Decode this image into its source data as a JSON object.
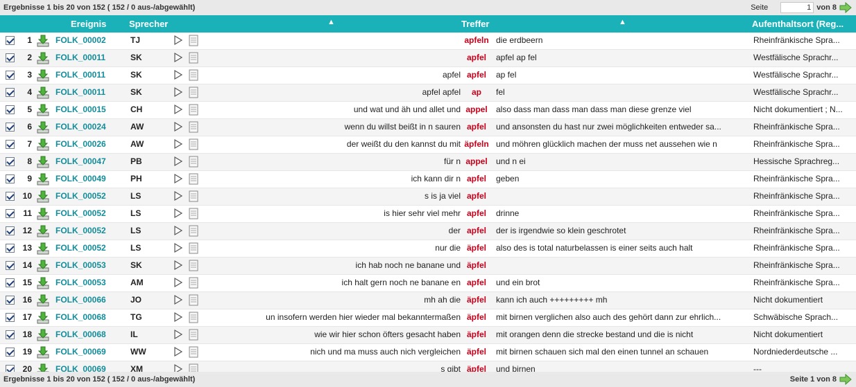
{
  "summary": "Ergebnisse 1 bis 20 von 152 ( 152 / 0 aus-/abgewählt)",
  "pager_top": {
    "label": "Seite",
    "value": "1",
    "suffix": "von 8"
  },
  "pager_bottom": {
    "text": "Seite 1 von 8"
  },
  "columns": {
    "event": "Ereignis",
    "speaker": "Sprecher",
    "match": "Treffer",
    "place": "Aufenthaltsort (Reg..."
  },
  "colors": {
    "header": "#1ab1b8",
    "link": "#138d9a",
    "match": "#c8001a",
    "arrow": "#5db34a"
  },
  "rows": [
    {
      "num": "1",
      "event": "FOLK_00002",
      "speaker": "TJ",
      "left": "",
      "match": "apfeln",
      "right": "die erdbeern",
      "place": "Rheinfränkische Spra..."
    },
    {
      "num": "2",
      "event": "FOLK_00011",
      "speaker": "SK",
      "left": "",
      "match": "apfel",
      "right": "apfel ap fel",
      "place": "Westfälische Sprachr..."
    },
    {
      "num": "3",
      "event": "FOLK_00011",
      "speaker": "SK",
      "left": "apfel",
      "match": "apfel",
      "right": "ap fel",
      "place": "Westfälische Sprachr..."
    },
    {
      "num": "4",
      "event": "FOLK_00011",
      "speaker": "SK",
      "left": "apfel apfel",
      "match": "ap",
      "right": "fel",
      "place": "Westfälische Sprachr..."
    },
    {
      "num": "5",
      "event": "FOLK_00015",
      "speaker": "CH",
      "left": "und wat und äh und allet und",
      "match": "appel",
      "right": "also dass man dass man dass man diese grenze viel",
      "place": "Nicht dokumentiert ; N..."
    },
    {
      "num": "6",
      "event": "FOLK_00024",
      "speaker": "AW",
      "left": "wenn du willst beißt in n sauren",
      "match": "apfel",
      "right": "und ansonsten du hast nur zwei möglichkeiten entweder sa...",
      "place": "Rheinfränkische Spra..."
    },
    {
      "num": "7",
      "event": "FOLK_00026",
      "speaker": "AW",
      "left": "der weißt du den kannst du mit",
      "match": "äpfeln",
      "right": "und möhren glücklich machen der muss net aussehen wie n",
      "place": "Rheinfränkische Spra..."
    },
    {
      "num": "8",
      "event": "FOLK_00047",
      "speaker": "PB",
      "left": "für n",
      "match": "appel",
      "right": "und n ei",
      "place": "Hessische Sprachreg..."
    },
    {
      "num": "9",
      "event": "FOLK_00049",
      "speaker": "PH",
      "left": "ich kann dir n",
      "match": "apfel",
      "right": "geben",
      "place": "Rheinfränkische Spra..."
    },
    {
      "num": "10",
      "event": "FOLK_00052",
      "speaker": "LS",
      "left": "s is ja viel",
      "match": "apfel",
      "right": "",
      "place": "Rheinfränkische Spra..."
    },
    {
      "num": "11",
      "event": "FOLK_00052",
      "speaker": "LS",
      "left": "is hier sehr viel mehr",
      "match": "apfel",
      "right": "drinne",
      "place": "Rheinfränkische Spra..."
    },
    {
      "num": "12",
      "event": "FOLK_00052",
      "speaker": "LS",
      "left": "der",
      "match": "apfel",
      "right": "der is irgendwie so klein geschrotet",
      "place": "Rheinfränkische Spra..."
    },
    {
      "num": "13",
      "event": "FOLK_00052",
      "speaker": "LS",
      "left": "nur die",
      "match": "äpfel",
      "right": "also des is total naturbelassen is einer seits auch halt",
      "place": "Rheinfränkische Spra..."
    },
    {
      "num": "14",
      "event": "FOLK_00053",
      "speaker": "SK",
      "left": "ich hab noch ne banane und",
      "match": "äpfel",
      "right": "",
      "place": "Rheinfränkische Spra..."
    },
    {
      "num": "15",
      "event": "FOLK_00053",
      "speaker": "AM",
      "left": "ich halt gern noch ne banane en",
      "match": "apfel",
      "right": "und ein brot",
      "place": "Rheinfränkische Spra..."
    },
    {
      "num": "16",
      "event": "FOLK_00066",
      "speaker": "JO",
      "left": "mh ah die",
      "match": "äpfel",
      "right": "kann ich auch +++++++++ mh",
      "place": "Nicht dokumentiert"
    },
    {
      "num": "17",
      "event": "FOLK_00068",
      "speaker": "TG",
      "left": "un insofern werden hier wieder mal bekanntermaßen",
      "match": "äpfel",
      "right": "mit birnen verglichen also auch des gehört dann zur ehrlich...",
      "place": "Schwäbische Sprach..."
    },
    {
      "num": "18",
      "event": "FOLK_00068",
      "speaker": "IL",
      "left": "wie wir hier schon öfters gesacht haben",
      "match": "äpfel",
      "right": "mit orangen denn die strecke bestand und die is nicht",
      "place": "Nicht dokumentiert"
    },
    {
      "num": "19",
      "event": "FOLK_00069",
      "speaker": "WW",
      "left": "nich und ma muss auch nich vergleichen",
      "match": "äpfel",
      "right": "mit birnen schauen sich mal den einen tunnel an schauen",
      "place": "Nordniederdeutsche ..."
    },
    {
      "num": "20",
      "event": "FOLK_00069",
      "speaker": "XM",
      "left": "s gibt",
      "match": "äpfel",
      "right": "und birnen",
      "place": "---"
    }
  ]
}
